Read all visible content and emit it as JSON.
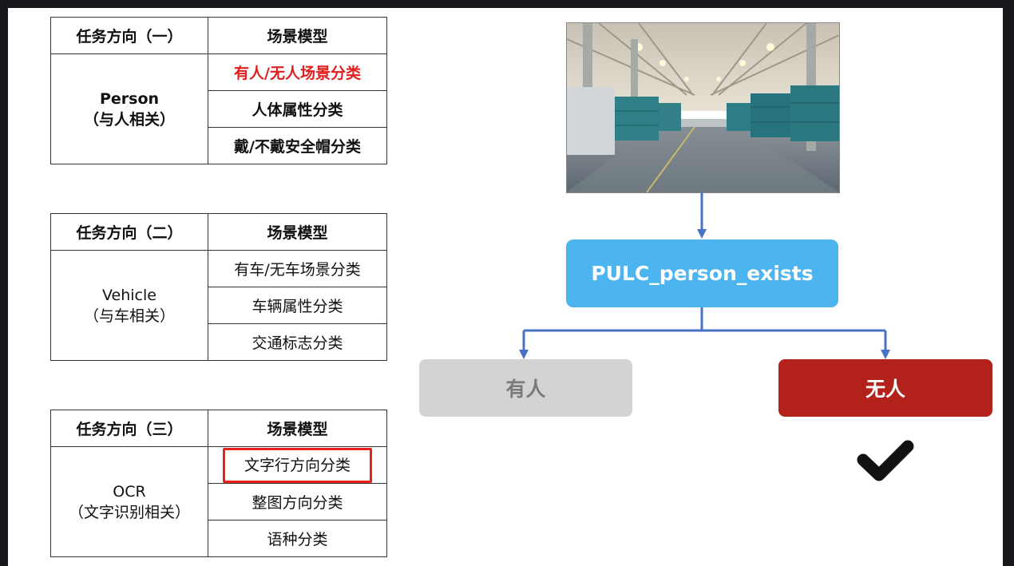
{
  "tables": [
    {
      "header": {
        "task": "任务方向（一）",
        "model": "场景模型"
      },
      "category": {
        "name": "Person",
        "desc": "（与人相关）"
      },
      "models": [
        "有人/无人场景分类",
        "人体属性分类",
        "戴/不戴安全帽分类"
      ]
    },
    {
      "header": {
        "task": "任务方向（二）",
        "model": "场景模型"
      },
      "category": {
        "name": "Vehicle",
        "desc": "（与车相关）"
      },
      "models": [
        "有车/无车场景分类",
        "车辆属性分类",
        "交通标志分类"
      ]
    },
    {
      "header": {
        "task": "任务方向（三）",
        "model": "场景模型"
      },
      "category": {
        "name": "OCR",
        "desc": "（文字识别相关）"
      },
      "models": [
        "文字行方向分类",
        "整图方向分类",
        "语种分类"
      ]
    }
  ],
  "flow": {
    "model_name": "PULC_person_exists",
    "result_yes": "有人",
    "result_no": "无人"
  },
  "colors": {
    "model_box": "#4cb4ee",
    "result_yes_box": "#d3d3d3",
    "result_no_box": "#b3211b",
    "highlight_text": "#e02020",
    "highlight_border": "#e8211b",
    "arrow": "#4a72c4"
  },
  "icons": {
    "check": "check-icon",
    "photo": "warehouse-photo"
  }
}
